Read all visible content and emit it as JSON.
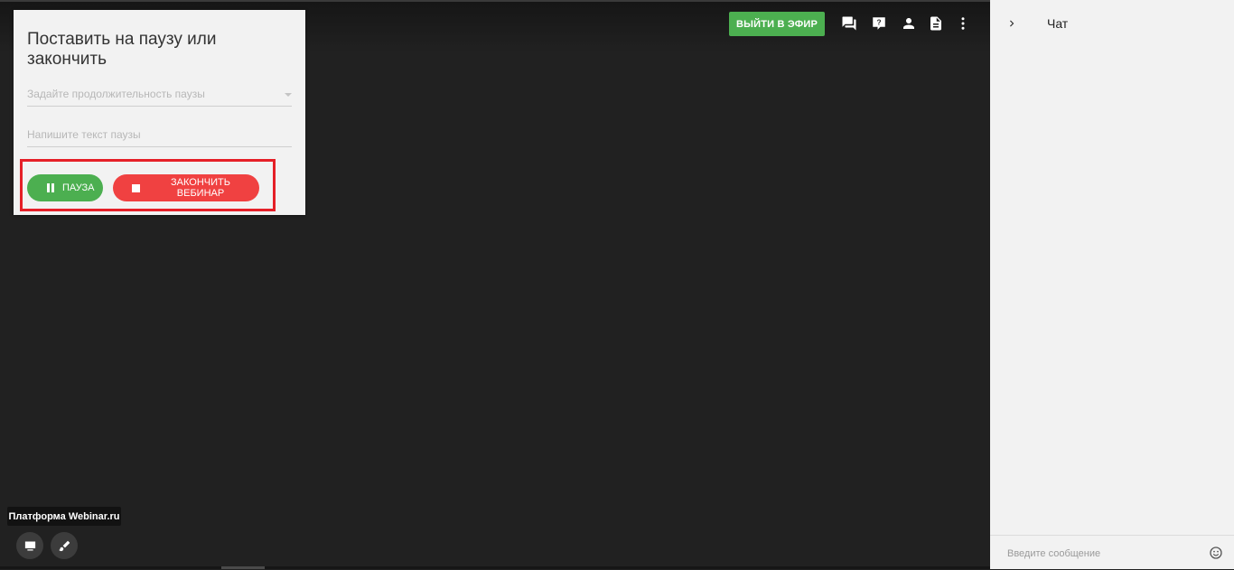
{
  "header": {
    "go_live_label": "ВЫЙТИ В ЭФИР",
    "icons": [
      "chat-icon",
      "question-icon",
      "person-icon",
      "file-icon",
      "more-vert-icon"
    ]
  },
  "pause_panel": {
    "title": "Поставить на паузу или закончить",
    "duration_placeholder": "Задайте продолжительность паузы",
    "text_placeholder": "Напишите текст паузы",
    "pause_label": "ПАУЗА",
    "end_label": "ЗАКОНЧИТЬ ВЕБИНАР"
  },
  "footer": {
    "tooltip": "Платформа Webinar.ru",
    "icons": [
      "screen-icon",
      "brush-icon"
    ]
  },
  "chat": {
    "title": "Чат",
    "input_placeholder": "Введите сообщение"
  },
  "colors": {
    "stage_bg": "#212121",
    "accent_green": "#4caf50",
    "danger_red": "#f04141",
    "highlight_red": "#e52028",
    "panel_bg": "#f2f2f2"
  }
}
